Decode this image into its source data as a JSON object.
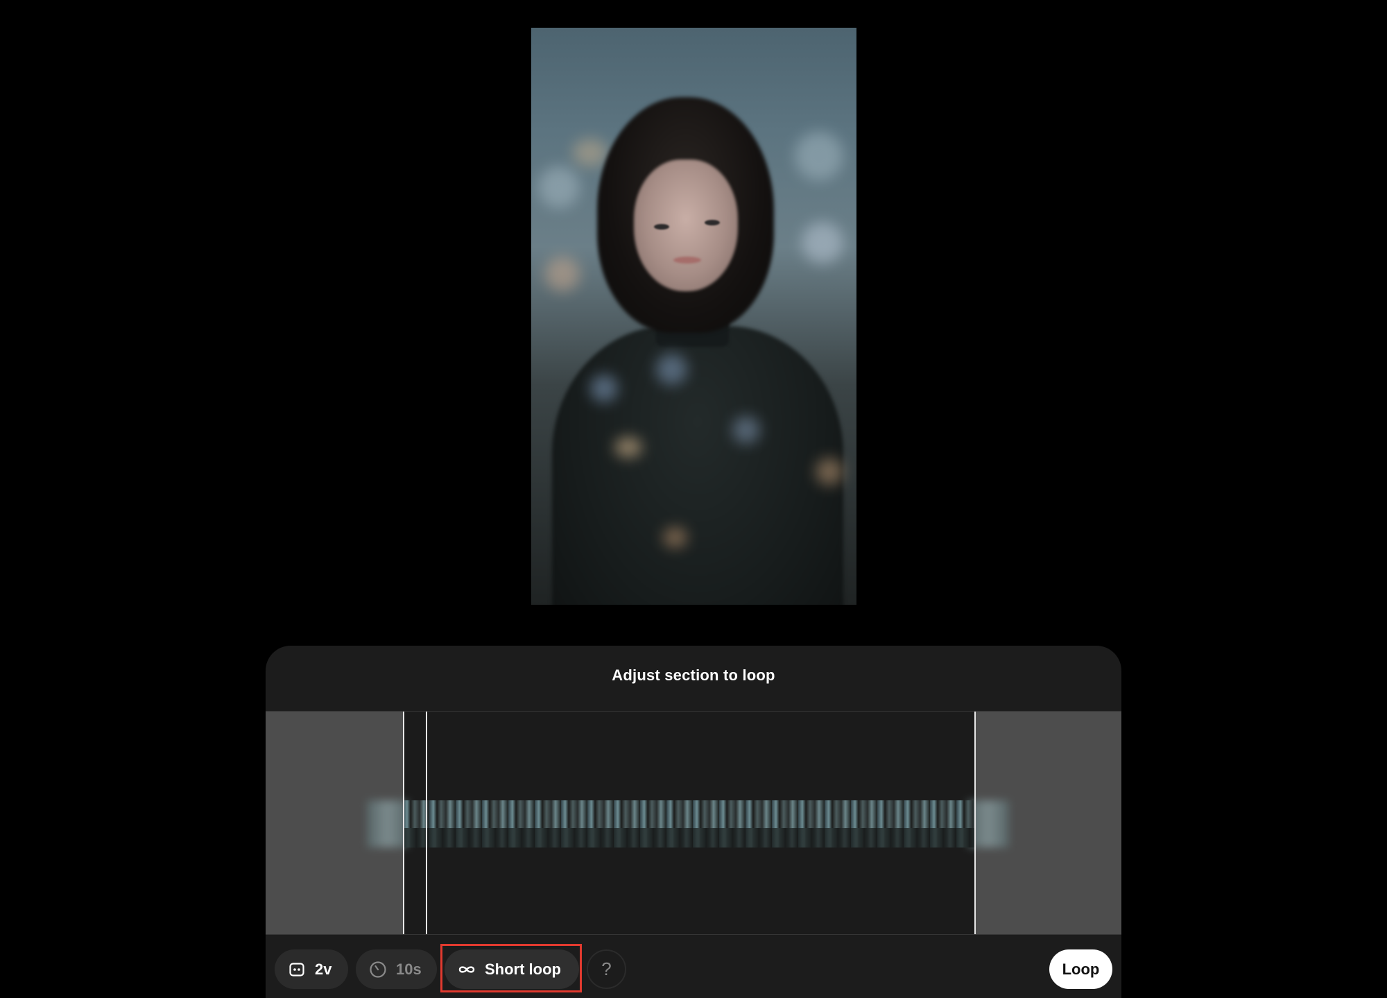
{
  "panel": {
    "title": "Adjust section to loop"
  },
  "toolbar": {
    "model_label": "2v",
    "duration_label": "10s",
    "loop_mode_label": "Short loop",
    "help_label": "?",
    "loop_button_label": "Loop"
  },
  "icons": {
    "model": "model-icon",
    "duration": "clock-icon",
    "loop_mode": "infinity-icon"
  },
  "colors": {
    "highlight": "#e23a2f",
    "panel_bg": "#1c1c1c",
    "trim_handle": "#e8e8e8"
  }
}
